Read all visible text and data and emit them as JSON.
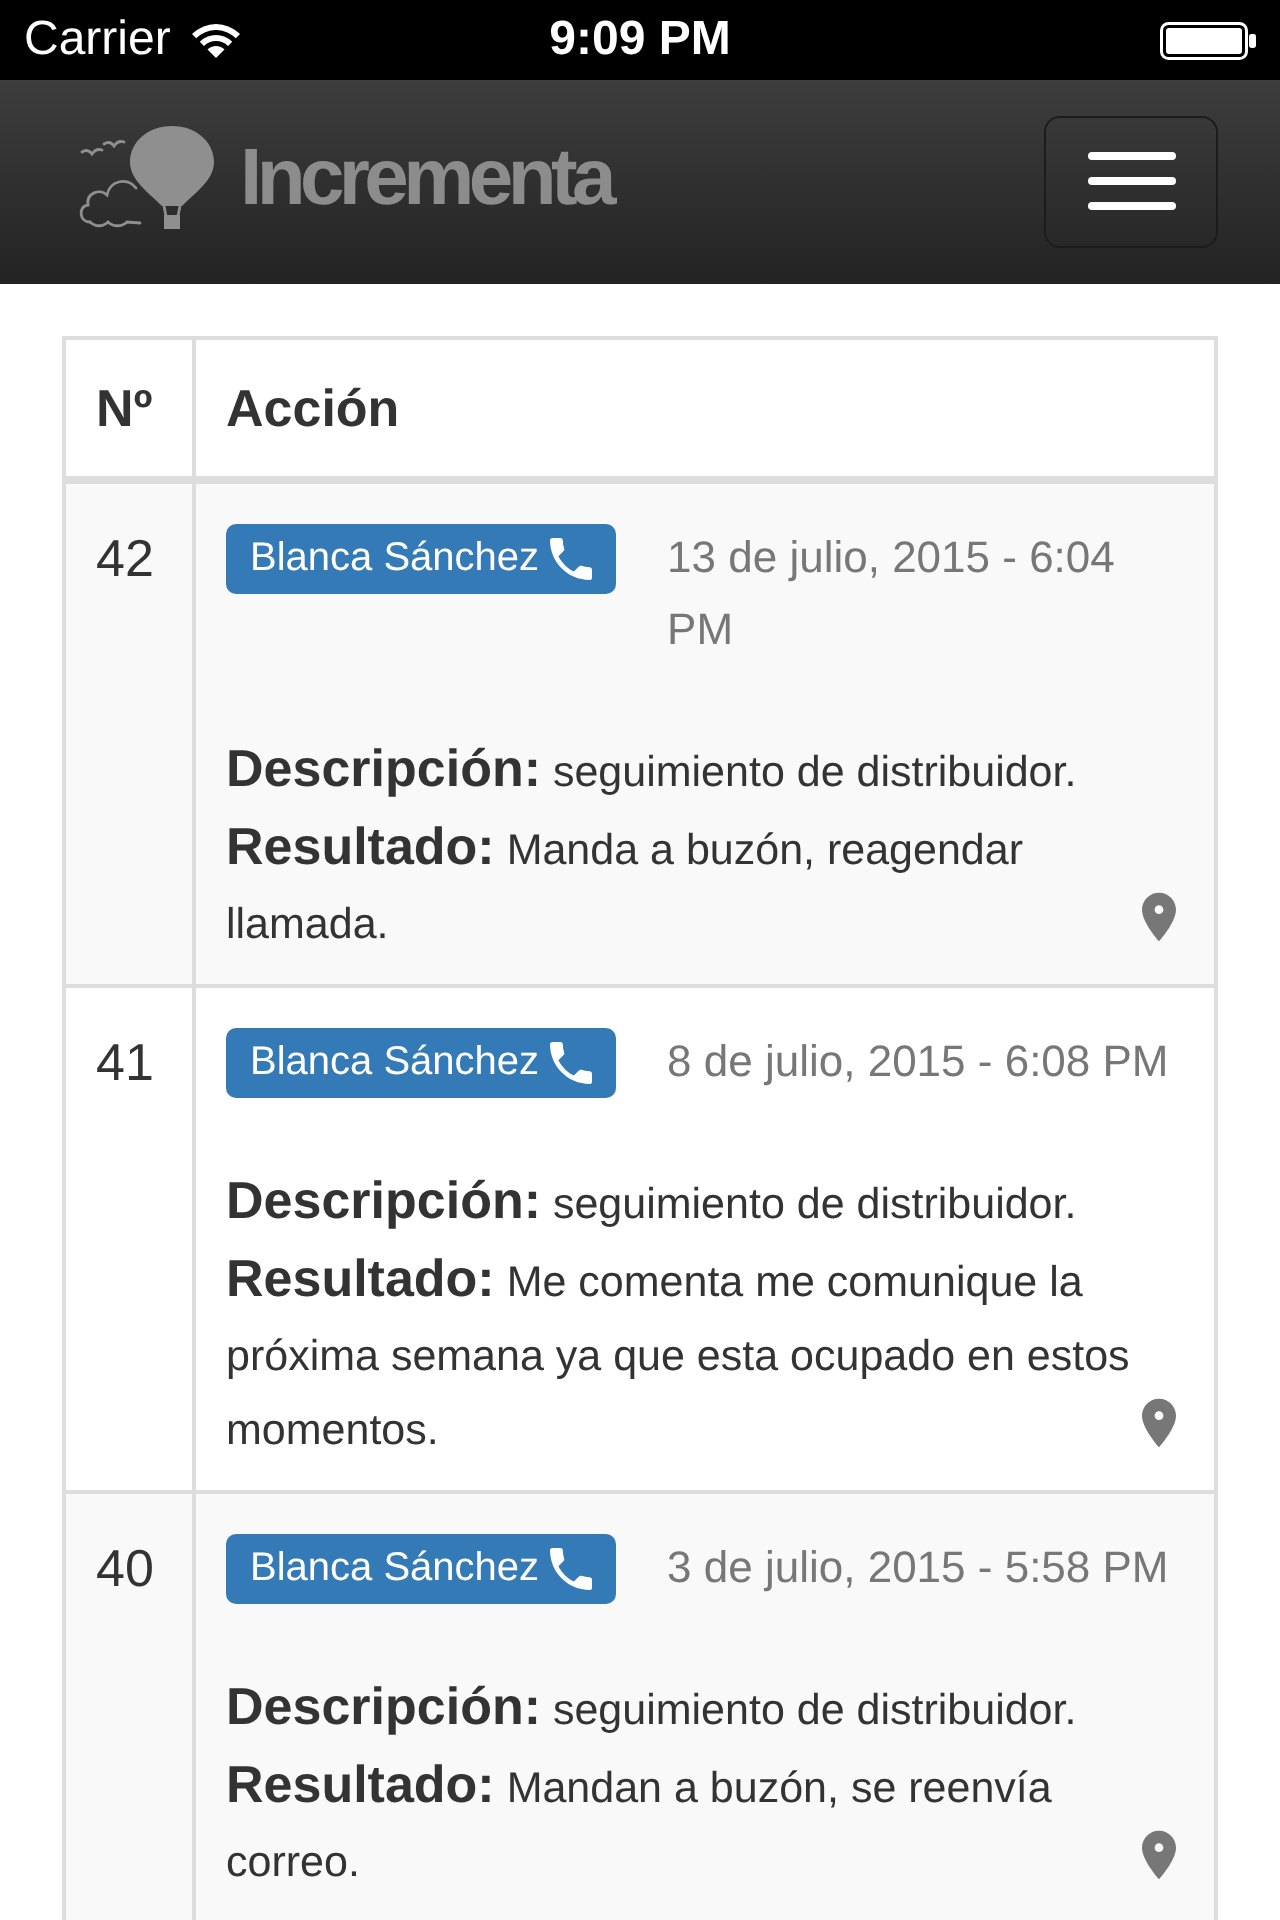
{
  "status_bar": {
    "carrier": "Carrier",
    "time": "9:09 PM"
  },
  "navbar": {
    "brand": "Incrementa"
  },
  "table": {
    "columns": [
      "Nº",
      "Acción"
    ],
    "rows": [
      {
        "number": "42",
        "contact": "Blanca Sánchez",
        "date": "13 de julio, 2015 - 6:04 PM",
        "description": "**Descripción:** seguimiento de distribuidor.",
        "result": "**Resultado:** Manda a buzón, reagendar llamada."
      },
      {
        "number": "41",
        "contact": "Blanca Sánchez",
        "date": "8 de julio, 2015 - 6:08 PM",
        "description": "**Descripción:** seguimiento de distribuidor.",
        "result": "**Resultado:** Me comenta me comunique la próxima semana ya que esta ocupado en estos momentos."
      },
      {
        "number": "40",
        "contact": "Blanca Sánchez",
        "date": "3 de julio, 2015 - 5:58 PM",
        "description": "**Descripción:** seguimiento de distribuidor.",
        "result": "**Resultado:** Mandan a buzón, se reenvía correo."
      }
    ]
  }
}
